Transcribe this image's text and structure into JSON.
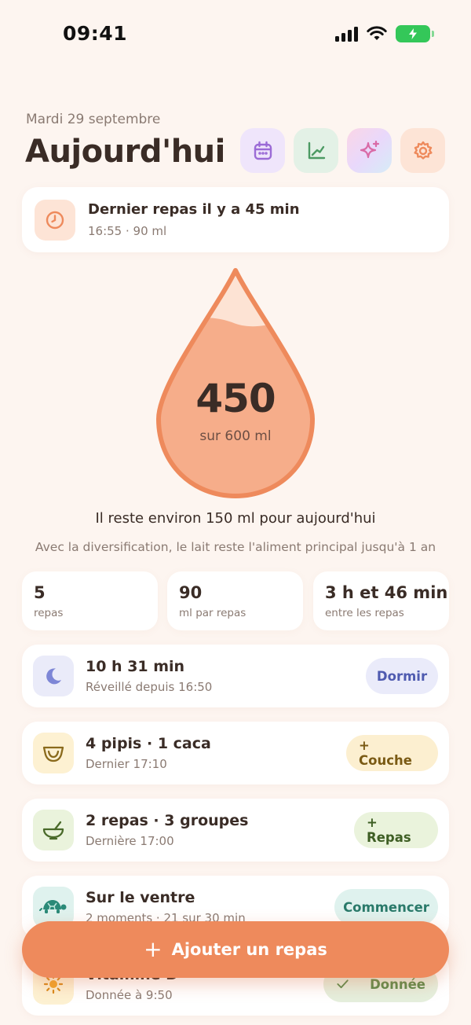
{
  "status_bar": {
    "time": "09:41"
  },
  "header": {
    "date": "Mardi 29 septembre",
    "title": "Aujourd'hui",
    "buttons": [
      {
        "icon": "calendar-icon",
        "bg": "#efe5fb",
        "color": "#9b6bd6"
      },
      {
        "icon": "chart-icon",
        "bg": "#e3f1e6",
        "color": "#4c9a63"
      },
      {
        "icon": "sparkle-icon",
        "bg": "#f6dcec",
        "color": "#d96aa6"
      },
      {
        "icon": "gear-icon",
        "bg": "#fde4d6",
        "color": "#ee8a5c"
      }
    ]
  },
  "last_meal": {
    "title": "Dernier repas il y a 45 min",
    "subtitle": "16:55 · 90 ml",
    "icon": "clock-icon"
  },
  "intake": {
    "value": "450",
    "label": "sur 600 ml",
    "fill_fraction": 0.75
  },
  "remaining_text": "Il reste environ 150 ml pour aujourd'hui",
  "tip": "Avec la diversification, le lait reste l'aliment principal jusqu'à 1 an",
  "stats": [
    {
      "value": "5",
      "label": "repas"
    },
    {
      "value": "90",
      "label": "ml par repas"
    },
    {
      "value": "3 h et 46 min",
      "label": "entre les repas"
    }
  ],
  "rows": [
    {
      "title": "10 h 31 min",
      "subtitle": "Réveillé depuis 16:50",
      "button": "Dormir",
      "icon": "moon-icon",
      "icon_bg": "#eaebf9",
      "btn_bg": "#eaebfa",
      "btn_color": "#4f5bb0"
    },
    {
      "title": "4 pipis · 1 caca",
      "subtitle": "Dernier 17:10",
      "button": "+ Couche",
      "icon": "diaper-icon",
      "icon_bg": "#fdf1d2",
      "btn_bg": "#fcefd0",
      "btn_color": "#7a5a14"
    },
    {
      "title": "2 repas · 3 groupes",
      "subtitle": "Dernière 17:00",
      "button": "+ Repas",
      "icon": "bowl-icon",
      "icon_bg": "#eaf3dc",
      "btn_bg": "#eaf3dc",
      "btn_color": "#3e5e24"
    },
    {
      "title": "Sur le ventre",
      "subtitle": "2 moments · 21 sur 30 min",
      "button": "Commencer",
      "icon": "turtle-icon",
      "icon_bg": "#dff2ee",
      "btn_bg": "#dff2ee",
      "btn_color": "#2a7a6a"
    },
    {
      "title": "Vitamine D",
      "subtitle": "Donnée à 9:50",
      "button": "Donnée",
      "icon": "sun-icon",
      "icon_bg": "#fdf1d2",
      "btn_bg": "#e5efdd",
      "btn_color": "#5a8a4a"
    }
  ],
  "fab": {
    "label": "Ajouter un repas"
  }
}
